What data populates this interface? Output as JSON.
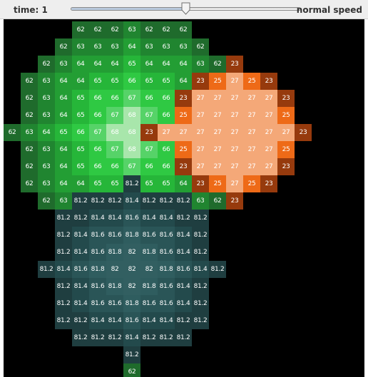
{
  "toolbar": {
    "time_label": "time: 1",
    "speed_label": "normal speed",
    "speed_slider_value": 0.5
  },
  "colors": {
    "background": "#000000",
    "green_scale": [
      "#1f6b2c",
      "#208530",
      "#239e34",
      "#26b639",
      "#2fc943",
      "#56d368",
      "#7fdb8c",
      "#a8e6ab"
    ],
    "orange_scale": [
      "#963a0d",
      "#d9520c",
      "#ee6a17",
      "#f0843e",
      "#f4a878"
    ],
    "teal_scale": [
      "#19383a",
      "#1f3e40",
      "#234a4c",
      "#2a5557",
      "#2f5d5f",
      "#325f61",
      "#3a6a6c"
    ]
  },
  "grid": {
    "rows": [
      [
        "",
        "",
        "",
        "",
        "62",
        "62",
        "62",
        "63",
        "62",
        "62",
        "62",
        "",
        "",
        "",
        "",
        "",
        "",
        ""
      ],
      [
        "",
        "",
        "",
        "62",
        "63",
        "63",
        "63",
        "64",
        "63",
        "63",
        "63",
        "62",
        "",
        "",
        "",
        "",
        "",
        ""
      ],
      [
        "",
        "",
        "62",
        "63",
        "64",
        "64",
        "64",
        "65",
        "64",
        "64",
        "64",
        "63",
        "62",
        "23",
        "",
        "",
        "",
        ""
      ],
      [
        "",
        "62",
        "63",
        "64",
        "64",
        "65",
        "65",
        "66",
        "65",
        "65",
        "64",
        "23",
        "25",
        "27",
        "25",
        "23",
        "",
        ""
      ],
      [
        "",
        "62",
        "63",
        "64",
        "65",
        "66",
        "66",
        "67",
        "66",
        "66",
        "23",
        "27",
        "27",
        "27",
        "27",
        "27",
        "23",
        ""
      ],
      [
        "",
        "62",
        "63",
        "64",
        "65",
        "66",
        "67",
        "68",
        "67",
        "66",
        "25",
        "27",
        "27",
        "27",
        "27",
        "27",
        "25",
        ""
      ],
      [
        "62",
        "63",
        "64",
        "65",
        "66",
        "67",
        "68",
        "68",
        "23",
        "27",
        "27",
        "27",
        "27",
        "27",
        "27",
        "27",
        "27",
        "23"
      ],
      [
        "",
        "62",
        "63",
        "64",
        "65",
        "66",
        "67",
        "68",
        "67",
        "66",
        "25",
        "27",
        "27",
        "27",
        "27",
        "27",
        "25",
        ""
      ],
      [
        "",
        "62",
        "63",
        "64",
        "65",
        "66",
        "66",
        "67",
        "66",
        "66",
        "23",
        "27",
        "27",
        "27",
        "27",
        "27",
        "23",
        ""
      ],
      [
        "",
        "62",
        "63",
        "64",
        "64",
        "65",
        "65",
        "81.2",
        "65",
        "65",
        "64",
        "23",
        "25",
        "27",
        "25",
        "23",
        "",
        ""
      ],
      [
        "",
        "",
        "62",
        "63",
        "81.2",
        "81.2",
        "81.2",
        "81.4",
        "81.2",
        "81.2",
        "81.2",
        "63",
        "62",
        "23",
        "",
        "",
        "",
        ""
      ],
      [
        "",
        "",
        "",
        "81.2",
        "81.2",
        "81.4",
        "81.4",
        "81.6",
        "81.4",
        "81.4",
        "81.2",
        "81.2",
        "",
        "",
        "",
        "",
        "",
        ""
      ],
      [
        "",
        "",
        "",
        "81.2",
        "81.4",
        "81.6",
        "81.6",
        "81.8",
        "81.6",
        "81.6",
        "81.4",
        "81.2",
        "",
        "",
        "",
        "",
        "",
        ""
      ],
      [
        "",
        "",
        "",
        "81.2",
        "81.4",
        "81.6",
        "81.8",
        "82",
        "81.8",
        "81.6",
        "81.4",
        "81.2",
        "",
        "",
        "",
        "",
        "",
        ""
      ],
      [
        "",
        "",
        "81.2",
        "81.4",
        "81.6",
        "81.8",
        "82",
        "82",
        "82",
        "81.8",
        "81.6",
        "81.4",
        "81.2",
        "",
        "",
        "",
        "",
        ""
      ],
      [
        "",
        "",
        "",
        "81.2",
        "81.4",
        "81.6",
        "81.8",
        "82",
        "81.8",
        "81.6",
        "81.4",
        "81.2",
        "",
        "",
        "",
        "",
        "",
        ""
      ],
      [
        "",
        "",
        "",
        "81.2",
        "81.4",
        "81.6",
        "81.6",
        "81.8",
        "81.6",
        "81.6",
        "81.4",
        "81.2",
        "",
        "",
        "",
        "",
        "",
        ""
      ],
      [
        "",
        "",
        "",
        "81.2",
        "81.2",
        "81.4",
        "81.4",
        "81.6",
        "81.4",
        "81.4",
        "81.2",
        "81.2",
        "",
        "",
        "",
        "",
        "",
        ""
      ],
      [
        "",
        "",
        "",
        "",
        "81.2",
        "81.2",
        "81.2",
        "81.4",
        "81.2",
        "81.2",
        "81.2",
        "",
        "",
        "",
        "",
        "",
        "",
        ""
      ],
      [
        "",
        "",
        "",
        "",
        "",
        "",
        "",
        "81.2",
        "",
        "",
        "",
        "",
        "",
        "",
        "",
        "",
        "",
        ""
      ],
      [
        "",
        "",
        "",
        "",
        "",
        "",
        "",
        "62",
        "",
        "",
        "",
        "",
        "",
        "",
        "",
        "",
        "",
        ""
      ]
    ]
  }
}
